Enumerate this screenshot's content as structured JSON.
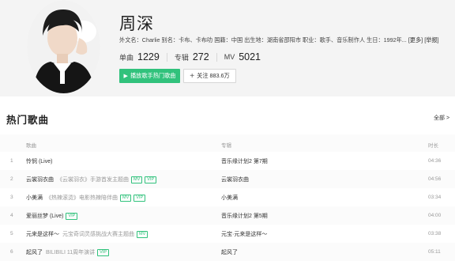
{
  "artist": {
    "name": "周深",
    "meta_text": "外文名：Charlie 别名：卡布、卡布叻 国籍：中国 出生地：湖南省邵阳市 职业：歌手、音乐制作人 生日：1992年...",
    "meta_more": "[更多]",
    "meta_report": "[举报]"
  },
  "stats": [
    {
      "label": "单曲",
      "value": "1229"
    },
    {
      "label": "专辑",
      "value": "272"
    },
    {
      "label": "MV",
      "value": "5021"
    }
  ],
  "buttons": {
    "play_label": "播放歌手热门歌曲",
    "follow_label": "关注 883.6万"
  },
  "section": {
    "title": "热门歌曲",
    "all_label": "全部 >"
  },
  "table": {
    "headers": {
      "song": "歌曲",
      "album": "专辑",
      "duration": "时长"
    },
    "rows": [
      {
        "index": "1",
        "title": "怜悯 (Live)",
        "sub": "",
        "tags": [],
        "album": "音乐缘计划2 第7期",
        "duration": "04:36"
      },
      {
        "index": "2",
        "title": "云裳羽衣曲",
        "sub": "《云裳羽衣》手游首发主题曲",
        "tags": [
          "MV",
          "VIP"
        ],
        "album": "云裳羽衣曲",
        "duration": "04:56"
      },
      {
        "index": "3",
        "title": "小美满",
        "sub": "《热辣滚烫》电影热辣陪伴曲",
        "tags": [
          "MV",
          "VIP"
        ],
        "album": "小美满",
        "duration": "03:34"
      },
      {
        "index": "4",
        "title": "爱丽丝梦 (Live)",
        "sub": "",
        "tags": [
          "VIP"
        ],
        "album": "音乐缘计划2 第5期",
        "duration": "04:00"
      },
      {
        "index": "5",
        "title": "元来是这样～",
        "sub": "元宝奇词灵感挑战大赛主题曲",
        "tags": [
          "MV"
        ],
        "album": "元宝·元来是这样～",
        "duration": "03:38"
      },
      {
        "index": "6",
        "title": "起风了",
        "sub": "BILIBILI 11周年演讲",
        "tags": [
          "VIP"
        ],
        "album": "起风了",
        "duration": "05:11"
      }
    ]
  },
  "colors": {
    "accent": "#31c27c",
    "header_bg": "#f4f4f4"
  }
}
